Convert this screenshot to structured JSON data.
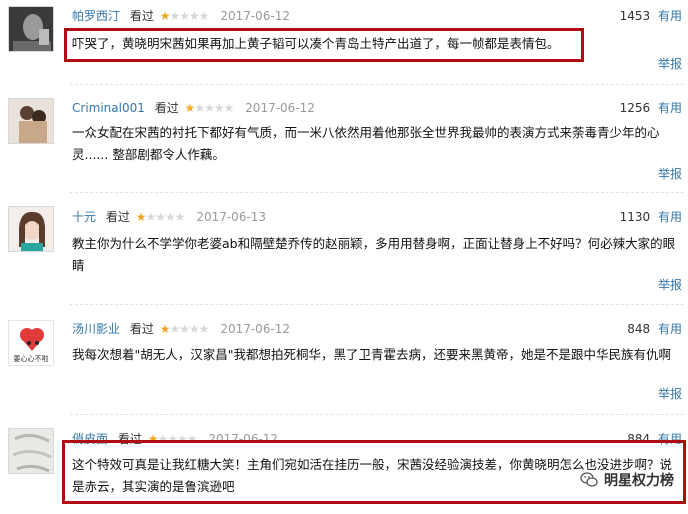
{
  "comments": [
    {
      "user": "帕罗西汀",
      "status": "看过",
      "stars": 1,
      "date": "2017-06-12",
      "votes": "1453",
      "useful": "有用",
      "text": "吓哭了，黄晓明宋茜如果再加上黄子韬可以凑个青岛土特产出道了，每一帧都是表情包。",
      "report": "举报",
      "highlighted": true
    },
    {
      "user": "Criminal001",
      "status": "看过",
      "stars": 1,
      "date": "2017-06-12",
      "votes": "1256",
      "useful": "有用",
      "text": "一众女配在宋茜的衬托下都好有气质，而一米八依然用着他那张全世界我最帅的表演方式来荼毒青少年的心灵...... 整部剧都令人作藕。",
      "report": "举报",
      "highlighted": false
    },
    {
      "user": "十元",
      "status": "看过",
      "stars": 1,
      "date": "2017-06-13",
      "votes": "1130",
      "useful": "有用",
      "text": "教主你为什么不学学你老婆ab和隔壁楚乔传的赵丽颖，多用用替身啊，正面让替身上不好吗？何必辣大家的眼睛",
      "report": "举报",
      "highlighted": false
    },
    {
      "user": "汤川影业",
      "status": "看过",
      "stars": 1,
      "date": "2017-06-12",
      "votes": "848",
      "useful": "有用",
      "text": "我每次想着\"胡无人，汉家昌\"我都想拍死桐华，黑了卫青霍去病，还要来黑黄帝，她是不是跟中华民族有仇啊",
      "report": "举报",
      "highlighted": false,
      "avatar_caption": "要心心不啦"
    },
    {
      "user": "俏皮面",
      "status": "看过",
      "stars": 1,
      "date": "2017-06-12",
      "votes": "884",
      "useful": "有用",
      "text": "这个特效可真是让我红糖大笑！主角们宛如活在挂历一般，宋茜没经验演技差，你黄晓明怎么也没进步啊？说是赤云，其实演的是鲁滨逊吧",
      "report": "",
      "highlighted": true
    }
  ],
  "watermark": {
    "text": "明星权力榜",
    "icon": "wechat-icon"
  },
  "colors": {
    "link": "#3377aa",
    "highlight": "#b00c12",
    "star": "#f5a623"
  }
}
